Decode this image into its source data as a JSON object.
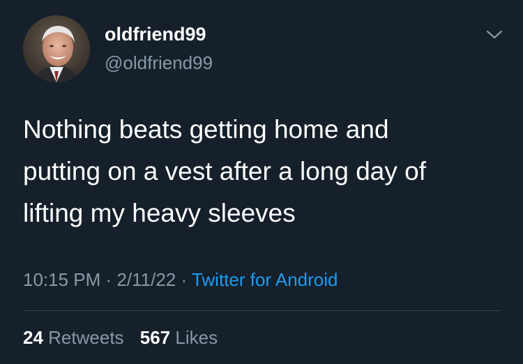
{
  "user": {
    "display_name": "oldfriend99",
    "handle": "@oldfriend99",
    "avatar_icon": "profile-photo-elderly-man"
  },
  "tweet": {
    "lines": [
      "Nothing beats getting home and",
      "putting on a vest after a long day of",
      "lifting my heavy sleeves"
    ]
  },
  "meta": {
    "time": "10:15 PM",
    "separator": "·",
    "date": "2/11/22",
    "source": "Twitter for Android"
  },
  "stats": {
    "retweets_count": "24",
    "retweets_label": "Retweets",
    "likes_count": "567",
    "likes_label": "Likes"
  },
  "colors": {
    "background": "#15202b",
    "secondary_text": "#8899a6",
    "link": "#1d9bf0",
    "divider": "#38444d"
  },
  "icons": {
    "menu": "chevron-down-icon"
  }
}
